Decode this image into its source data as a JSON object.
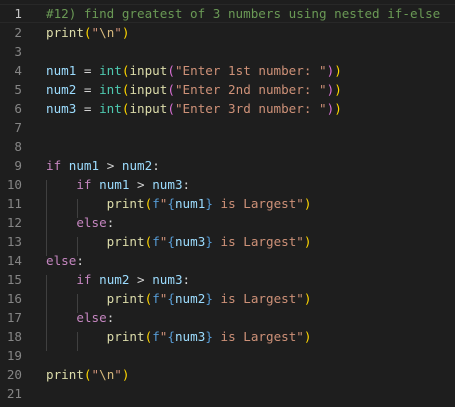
{
  "editor": {
    "lines": [
      {
        "n": "1",
        "tokens": [
          {
            "t": "#12) find greatest of 3 numbers using nested if-else",
            "c": "t-comment"
          }
        ]
      },
      {
        "n": "2",
        "tokens": [
          {
            "t": "print",
            "c": "t-func"
          },
          {
            "t": "(",
            "c": "t-p1"
          },
          {
            "t": "\"",
            "c": "t-str"
          },
          {
            "t": "\\n",
            "c": "t-esc"
          },
          {
            "t": "\"",
            "c": "t-str"
          },
          {
            "t": ")",
            "c": "t-p1"
          }
        ]
      },
      {
        "n": "3",
        "tokens": []
      },
      {
        "n": "4",
        "tokens": [
          {
            "t": "num1",
            "c": "t-var"
          },
          {
            "t": " = ",
            "c": "t-op"
          },
          {
            "t": "int",
            "c": "t-type"
          },
          {
            "t": "(",
            "c": "t-p1"
          },
          {
            "t": "input",
            "c": "t-func"
          },
          {
            "t": "(",
            "c": "t-p2"
          },
          {
            "t": "\"Enter 1st number: \"",
            "c": "t-str"
          },
          {
            "t": ")",
            "c": "t-p2"
          },
          {
            "t": ")",
            "c": "t-p1"
          }
        ]
      },
      {
        "n": "5",
        "tokens": [
          {
            "t": "num2",
            "c": "t-var"
          },
          {
            "t": " = ",
            "c": "t-op"
          },
          {
            "t": "int",
            "c": "t-type"
          },
          {
            "t": "(",
            "c": "t-p1"
          },
          {
            "t": "input",
            "c": "t-func"
          },
          {
            "t": "(",
            "c": "t-p2"
          },
          {
            "t": "\"Enter 2nd number: \"",
            "c": "t-str"
          },
          {
            "t": ")",
            "c": "t-p2"
          },
          {
            "t": ")",
            "c": "t-p1"
          }
        ]
      },
      {
        "n": "6",
        "tokens": [
          {
            "t": "num3",
            "c": "t-var"
          },
          {
            "t": " = ",
            "c": "t-op"
          },
          {
            "t": "int",
            "c": "t-type"
          },
          {
            "t": "(",
            "c": "t-p1"
          },
          {
            "t": "input",
            "c": "t-func"
          },
          {
            "t": "(",
            "c": "t-p2"
          },
          {
            "t": "\"Enter 3rd number: \"",
            "c": "t-str"
          },
          {
            "t": ")",
            "c": "t-p2"
          },
          {
            "t": ")",
            "c": "t-p1"
          }
        ]
      },
      {
        "n": "7",
        "tokens": []
      },
      {
        "n": "8",
        "tokens": []
      },
      {
        "n": "9",
        "tokens": [
          {
            "t": "if",
            "c": "t-kw"
          },
          {
            "t": " ",
            "c": "t-op"
          },
          {
            "t": "num1",
            "c": "t-var"
          },
          {
            "t": " > ",
            "c": "t-op"
          },
          {
            "t": "num2",
            "c": "t-var"
          },
          {
            "t": ":",
            "c": "t-op"
          }
        ]
      },
      {
        "n": "10",
        "tokens": [
          {
            "t": "    ",
            "c": "t-op"
          },
          {
            "t": "if",
            "c": "t-kw"
          },
          {
            "t": " ",
            "c": "t-op"
          },
          {
            "t": "num1",
            "c": "t-var"
          },
          {
            "t": " > ",
            "c": "t-op"
          },
          {
            "t": "num3",
            "c": "t-var"
          },
          {
            "t": ":",
            "c": "t-op"
          }
        ]
      },
      {
        "n": "11",
        "tokens": [
          {
            "t": "        ",
            "c": "t-op"
          },
          {
            "t": "print",
            "c": "t-func"
          },
          {
            "t": "(",
            "c": "t-p1"
          },
          {
            "t": "f",
            "c": "t-fpre"
          },
          {
            "t": "\"",
            "c": "t-str"
          },
          {
            "t": "{",
            "c": "t-brace"
          },
          {
            "t": "num1",
            "c": "t-var"
          },
          {
            "t": "}",
            "c": "t-brace"
          },
          {
            "t": " is Largest\"",
            "c": "t-str"
          },
          {
            "t": ")",
            "c": "t-p1"
          }
        ]
      },
      {
        "n": "12",
        "tokens": [
          {
            "t": "    ",
            "c": "t-op"
          },
          {
            "t": "else",
            "c": "t-kw"
          },
          {
            "t": ":",
            "c": "t-op"
          }
        ]
      },
      {
        "n": "13",
        "tokens": [
          {
            "t": "        ",
            "c": "t-op"
          },
          {
            "t": "print",
            "c": "t-func"
          },
          {
            "t": "(",
            "c": "t-p1"
          },
          {
            "t": "f",
            "c": "t-fpre"
          },
          {
            "t": "\"",
            "c": "t-str"
          },
          {
            "t": "{",
            "c": "t-brace"
          },
          {
            "t": "num3",
            "c": "t-var"
          },
          {
            "t": "}",
            "c": "t-brace"
          },
          {
            "t": " is Largest\"",
            "c": "t-str"
          },
          {
            "t": ")",
            "c": "t-p1"
          }
        ]
      },
      {
        "n": "14",
        "tokens": [
          {
            "t": "else",
            "c": "t-kw"
          },
          {
            "t": ":",
            "c": "t-op"
          }
        ]
      },
      {
        "n": "15",
        "tokens": [
          {
            "t": "    ",
            "c": "t-op"
          },
          {
            "t": "if",
            "c": "t-kw"
          },
          {
            "t": " ",
            "c": "t-op"
          },
          {
            "t": "num2",
            "c": "t-var"
          },
          {
            "t": " > ",
            "c": "t-op"
          },
          {
            "t": "num3",
            "c": "t-var"
          },
          {
            "t": ":",
            "c": "t-op"
          }
        ]
      },
      {
        "n": "16",
        "tokens": [
          {
            "t": "        ",
            "c": "t-op"
          },
          {
            "t": "print",
            "c": "t-func"
          },
          {
            "t": "(",
            "c": "t-p1"
          },
          {
            "t": "f",
            "c": "t-fpre"
          },
          {
            "t": "\"",
            "c": "t-str"
          },
          {
            "t": "{",
            "c": "t-brace"
          },
          {
            "t": "num2",
            "c": "t-var"
          },
          {
            "t": "}",
            "c": "t-brace"
          },
          {
            "t": " is Largest\"",
            "c": "t-str"
          },
          {
            "t": ")",
            "c": "t-p1"
          }
        ]
      },
      {
        "n": "17",
        "tokens": [
          {
            "t": "    ",
            "c": "t-op"
          },
          {
            "t": "else",
            "c": "t-kw"
          },
          {
            "t": ":",
            "c": "t-op"
          }
        ]
      },
      {
        "n": "18",
        "tokens": [
          {
            "t": "        ",
            "c": "t-op"
          },
          {
            "t": "print",
            "c": "t-func"
          },
          {
            "t": "(",
            "c": "t-p1"
          },
          {
            "t": "f",
            "c": "t-fpre"
          },
          {
            "t": "\"",
            "c": "t-str"
          },
          {
            "t": "{",
            "c": "t-brace"
          },
          {
            "t": "num3",
            "c": "t-var"
          },
          {
            "t": "}",
            "c": "t-brace"
          },
          {
            "t": " is Largest\"",
            "c": "t-str"
          },
          {
            "t": ")",
            "c": "t-p1"
          }
        ]
      },
      {
        "n": "19",
        "tokens": []
      },
      {
        "n": "20",
        "tokens": [
          {
            "t": "print",
            "c": "t-func"
          },
          {
            "t": "(",
            "c": "t-p1"
          },
          {
            "t": "\"",
            "c": "t-str"
          },
          {
            "t": "\\n",
            "c": "t-esc"
          },
          {
            "t": "\"",
            "c": "t-str"
          },
          {
            "t": ")",
            "c": "t-p1"
          }
        ]
      },
      {
        "n": "21",
        "tokens": []
      }
    ]
  },
  "colors": {
    "background": "#1e1e1e",
    "comment": "#6a9955",
    "function": "#dcdcaa",
    "string": "#ce9178",
    "variable": "#9cdcfe",
    "keyword": "#c586c0",
    "builtin_type": "#4ec9b0"
  }
}
